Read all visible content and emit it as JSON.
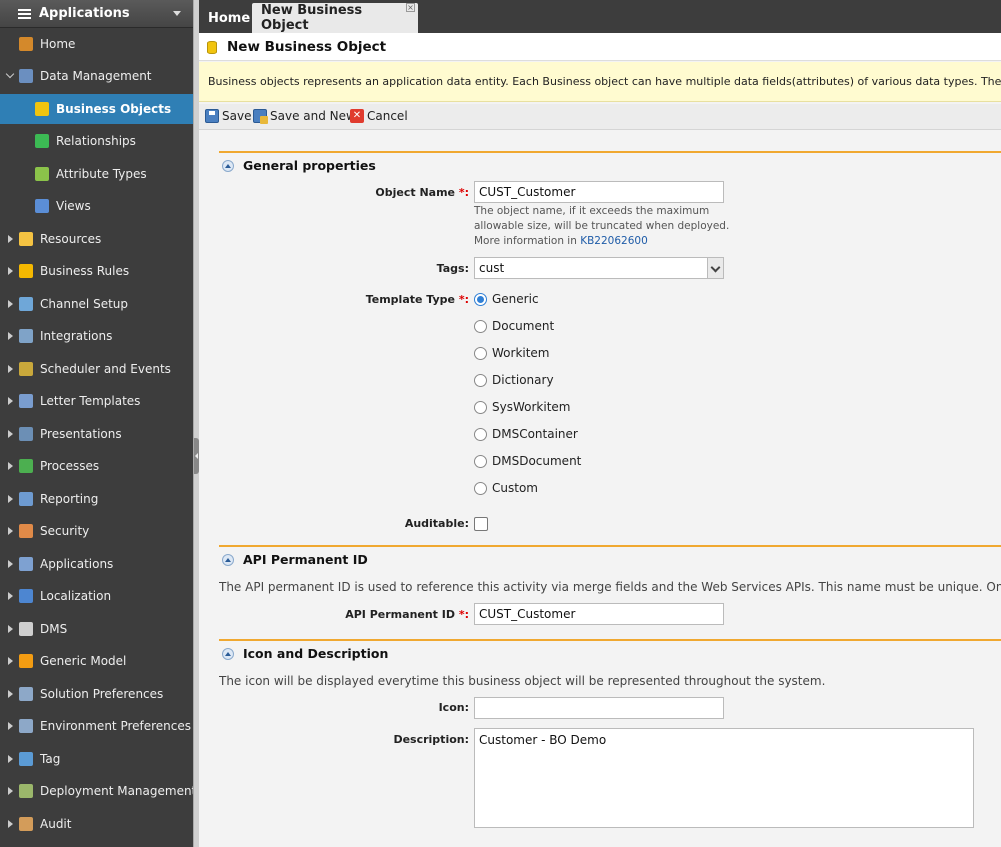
{
  "sidebar": {
    "title": "Applications",
    "items": [
      {
        "label": "Home",
        "name": "sidebar-item-home",
        "icon": "home-icon"
      },
      {
        "label": "Data Management",
        "name": "sidebar-item-data-management",
        "icon": "database-icon"
      },
      {
        "label": "Business Objects",
        "name": "sidebar-item-business-objects",
        "icon": "business-object-icon"
      },
      {
        "label": "Relationships",
        "name": "sidebar-item-relationships",
        "icon": "relationships-icon"
      },
      {
        "label": "Attribute Types",
        "name": "sidebar-item-attribute-types",
        "icon": "attribute-types-icon"
      },
      {
        "label": "Views",
        "name": "sidebar-item-views",
        "icon": "views-icon"
      },
      {
        "label": "Resources",
        "name": "sidebar-item-resources",
        "icon": "lightbulb-icon"
      },
      {
        "label": "Business Rules",
        "name": "sidebar-item-business-rules",
        "icon": "lightning-icon"
      },
      {
        "label": "Channel Setup",
        "name": "sidebar-item-channel-setup",
        "icon": "channel-icon"
      },
      {
        "label": "Integrations",
        "name": "sidebar-item-integrations",
        "icon": "integrations-icon"
      },
      {
        "label": "Scheduler and Events",
        "name": "sidebar-item-scheduler",
        "icon": "clock-icon"
      },
      {
        "label": "Letter Templates",
        "name": "sidebar-item-letter-templates",
        "icon": "letter-icon"
      },
      {
        "label": "Presentations",
        "name": "sidebar-item-presentations",
        "icon": "presentation-icon"
      },
      {
        "label": "Processes",
        "name": "sidebar-item-processes",
        "icon": "process-icon"
      },
      {
        "label": "Reporting",
        "name": "sidebar-item-reporting",
        "icon": "report-icon"
      },
      {
        "label": "Security",
        "name": "sidebar-item-security",
        "icon": "user-security-icon"
      },
      {
        "label": "Applications",
        "name": "sidebar-item-applications",
        "icon": "applications-icon"
      },
      {
        "label": "Localization",
        "name": "sidebar-item-localization",
        "icon": "localization-icon"
      },
      {
        "label": "DMS",
        "name": "sidebar-item-dms",
        "icon": "document-icon"
      },
      {
        "label": "Generic Model",
        "name": "sidebar-item-generic-model",
        "icon": "asterisk-icon"
      },
      {
        "label": "Solution Preferences",
        "name": "sidebar-item-solution-preferences",
        "icon": "preferences-icon"
      },
      {
        "label": "Environment Preferences",
        "name": "sidebar-item-environment-preferences",
        "icon": "preferences-icon"
      },
      {
        "label": "Tag",
        "name": "sidebar-item-tag",
        "icon": "code-tag-icon"
      },
      {
        "label": "Deployment Management",
        "name": "sidebar-item-deployment",
        "icon": "tag-icon"
      },
      {
        "label": "Audit",
        "name": "sidebar-item-audit",
        "icon": "audit-icon"
      }
    ]
  },
  "tabs": {
    "home": "Home",
    "current": "New Business Object",
    "close_glyph": "×"
  },
  "page": {
    "title": "New Business Object",
    "info": "Business objects represents an application data entity. Each Business object can have multiple data fields(attributes) of various data types. The system already has"
  },
  "toolbar": {
    "save": "Save",
    "save_and_new": "Save and New",
    "cancel": "Cancel"
  },
  "general": {
    "heading": "General properties",
    "object_name_label": "Object Name",
    "object_name_value": "CUST_Customer",
    "hint_line1": "The object name, if it exceeds the maximum",
    "hint_line2": "allowable size, will be truncated when deployed.",
    "hint_line3": "More information in ",
    "hint_link": "KB22062600",
    "tags_label": "Tags:",
    "tags_value": "cust",
    "template_type_label": "Template Type",
    "template_options": [
      "Generic",
      "Document",
      "Workitem",
      "Dictionary",
      "SysWorkitem",
      "DMSContainer",
      "DMSDocument",
      "Custom"
    ],
    "template_selected": "Generic",
    "auditable_label": "Auditable:",
    "required_marker": "*:"
  },
  "api": {
    "heading": "API Permanent ID",
    "description": "The API permanent ID is used to reference this activity via merge fields and the Web Services APIs. This name must be unique. Once this object is",
    "label": "API Permanent ID",
    "value": "CUST_Customer"
  },
  "icon_desc": {
    "heading": "Icon and Description",
    "description": "The icon will be displayed everytime this business object will be represented throughout the system.",
    "icon_label": "Icon:",
    "icon_value": "",
    "description_label": "Description:",
    "description_value": "Customer - BO Demo"
  },
  "colors": {
    "sidebar_bg": "#3d3d3d",
    "active_item": "#2f7fb5",
    "section_line": "#f0a830",
    "info_banner": "#fffbd0"
  }
}
